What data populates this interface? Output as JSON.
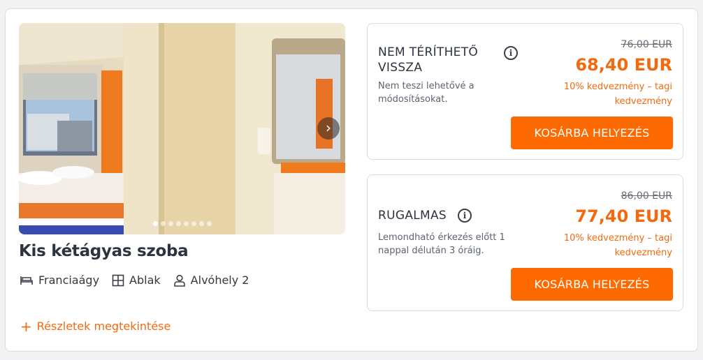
{
  "room": {
    "title": "Kis kétágyas szoba",
    "amenities": [
      {
        "icon": "bed-icon",
        "label": "Franciaágy"
      },
      {
        "icon": "window-icon",
        "label": "Ablak"
      },
      {
        "icon": "person-icon",
        "label": "Alvóhely 2"
      }
    ],
    "details_link": "Részletek megtekintése",
    "details_plus": "+",
    "gallery": {
      "next_glyph": "›",
      "image_count": 8,
      "active_index": 0
    }
  },
  "rates": [
    {
      "name": "NEM TÉRÍTHETŐ VISSZA",
      "name_line1": "NEM TÉRÍTHETŐ",
      "name_line2": "VISSZA",
      "info_glyph": "i",
      "description": "Nem teszi lehetővé a módosításokat.",
      "old_price": "76,00 EUR",
      "price": "68,40 EUR",
      "discount_line1": "10% kedvezmény – tagi",
      "discount_line2": "kedvezmény",
      "button": "KOSÁRBA HELYEZÉS"
    },
    {
      "name": "RUGALMAS",
      "info_glyph": "i",
      "description": "Lemondható érkezés előtt 1 nappal délután 3 óráig.",
      "old_price": "86,00 EUR",
      "price": "77,40 EUR",
      "discount_line1": "10% kedvezmény – tagi",
      "discount_line2": "kedvezmény",
      "button": "KOSÁRBA HELYEZÉS"
    }
  ],
  "colors": {
    "accent": "#ff6a00",
    "accent_text": "#f26a0f",
    "text": "#2d3440"
  }
}
